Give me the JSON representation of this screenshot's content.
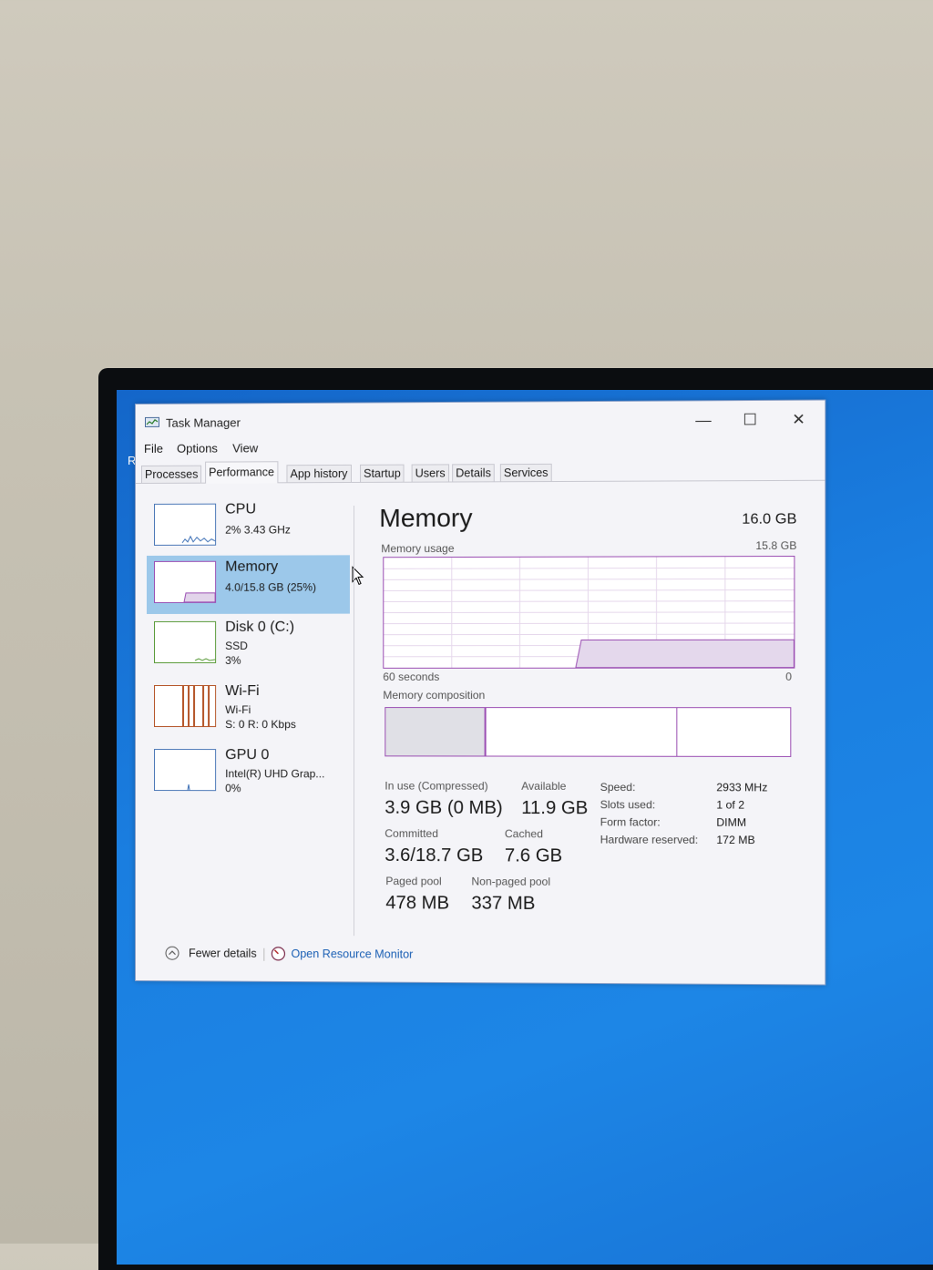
{
  "window": {
    "title": "Task Manager",
    "controls": {
      "minimize": "—",
      "maximize": "☐",
      "close": "✕"
    }
  },
  "menu": [
    "File",
    "Options",
    "View"
  ],
  "tabs": [
    {
      "label": "Processes",
      "active": false
    },
    {
      "label": "Performance",
      "active": true
    },
    {
      "label": "App history",
      "active": false
    },
    {
      "label": "Startup",
      "active": false
    },
    {
      "label": "Users",
      "active": false
    },
    {
      "label": "Details",
      "active": false
    },
    {
      "label": "Services",
      "active": false
    }
  ],
  "desktop_letter": "R",
  "sidebar": {
    "items": [
      {
        "title": "CPU",
        "sub1": "2% 3.43 GHz",
        "sub2": "",
        "selected": false
      },
      {
        "title": "Memory",
        "sub1": "4.0/15.8 GB (25%)",
        "sub2": "",
        "selected": true
      },
      {
        "title": "Disk 0 (C:)",
        "sub1": "SSD",
        "sub2": "3%",
        "selected": false
      },
      {
        "title": "Wi-Fi",
        "sub1": "Wi-Fi",
        "sub2": "S: 0 R: 0 Kbps",
        "selected": false
      },
      {
        "title": "GPU 0",
        "sub1": "Intel(R) UHD Grap...",
        "sub2": "0%",
        "selected": false
      }
    ]
  },
  "main": {
    "title": "Memory",
    "total": "16.0 GB",
    "usage_label": "Memory usage",
    "usage_max": "15.8 GB",
    "axis_left": "60 seconds",
    "axis_right": "0",
    "composition_label": "Memory composition",
    "usage_fraction": 0.25,
    "stats": {
      "in_use_label": "In use (Compressed)",
      "in_use_value": "3.9 GB (0 MB)",
      "available_label": "Available",
      "available_value": "11.9 GB",
      "committed_label": "Committed",
      "committed_value": "3.6/18.7 GB",
      "cached_label": "Cached",
      "cached_value": "7.6 GB",
      "paged_label": "Paged pool",
      "paged_value": "478 MB",
      "nonpaged_label": "Non-paged pool",
      "nonpaged_value": "337 MB"
    },
    "specs": [
      {
        "label": "Speed:",
        "value": "2933 MHz"
      },
      {
        "label": "Slots used:",
        "value": "1 of 2"
      },
      {
        "label": "Form factor:",
        "value": "DIMM"
      },
      {
        "label": "Hardware reserved:",
        "value": "172 MB"
      }
    ]
  },
  "footer": {
    "fewer_details": "Fewer details",
    "resource_monitor": "Open Resource Monitor"
  },
  "colors": {
    "accent_memory": "#9b4fb3",
    "selection": "#9cc8ea",
    "link": "#1a5fb4",
    "desktop": "#1a7ee0"
  }
}
